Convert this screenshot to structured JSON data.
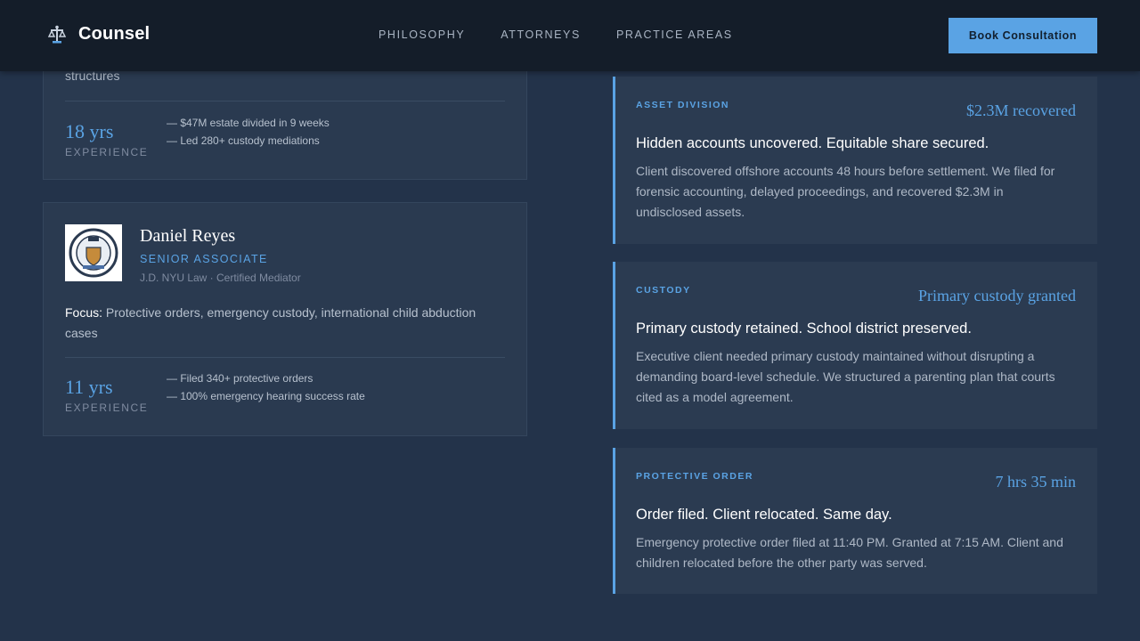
{
  "header": {
    "brand": "Counsel",
    "brand_icon": "scales-icon",
    "nav": [
      "PHILOSOPHY",
      "ATTORNEYS",
      "PRACTICE AREAS"
    ],
    "cta": "Book Consultation"
  },
  "attorneys": [
    {
      "partial_text": "structures",
      "years": "18 yrs",
      "years_label": "EXPERIENCE",
      "highlights": [
        "— $47M estate divided in 9 weeks",
        "— Led 280+ custody mediations"
      ]
    },
    {
      "name": "Daniel Reyes",
      "role": "SENIOR ASSOCIATE",
      "credentials": "J.D. NYU Law · Certified Mediator",
      "focus_label": "Focus:",
      "focus": "Protective orders, emergency custody, international child abduction cases",
      "years": "11 yrs",
      "years_label": "EXPERIENCE",
      "highlights": [
        "— Filed 340+ protective orders",
        "— 100% emergency hearing success rate"
      ]
    }
  ],
  "cases": [
    {
      "tag": "ASSET DIVISION",
      "result": "$2.3M recovered",
      "headline": "Hidden accounts uncovered. Equitable share secured.",
      "body": "Client discovered offshore accounts 48 hours before settlement. We filed for forensic accounting, delayed proceedings, and recovered $2.3M in undisclosed assets."
    },
    {
      "tag": "CUSTODY",
      "result": "Primary custody granted",
      "headline": "Primary custody retained. School district preserved.",
      "body": "Executive client needed primary custody maintained without disrupting a demanding board-level schedule. We structured a parenting plan that courts cited as a model agreement."
    },
    {
      "tag": "PROTECTIVE ORDER",
      "result": "7 hrs 35 min",
      "headline": "Order filed. Client relocated. Same day.",
      "body": "Emergency protective order filed at 11:40 PM. Granted at 7:15 AM. Client and children relocated before the other party was served."
    }
  ],
  "colors": {
    "accent": "#5aa3e4",
    "background": "#23334a",
    "header": "#141d29"
  }
}
